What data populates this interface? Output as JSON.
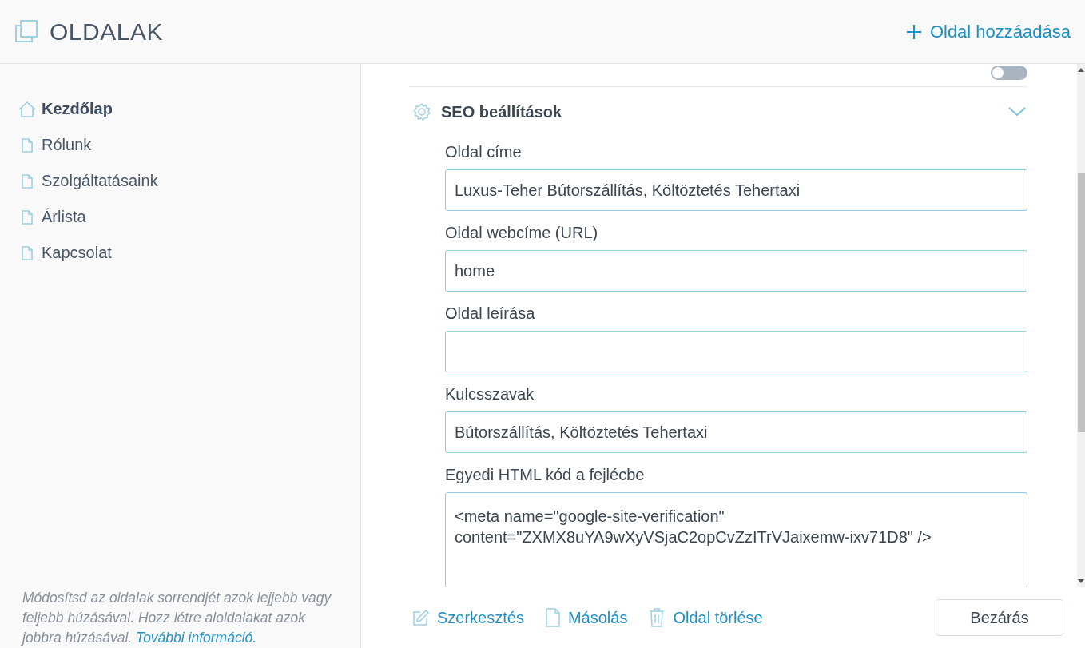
{
  "header": {
    "title": "OLDALAK",
    "add_button": "Oldal hozzáadása"
  },
  "sidebar": {
    "items": [
      {
        "label": "Kezdőlap",
        "kind": "home",
        "selected": true
      },
      {
        "label": "Rólunk",
        "kind": "page",
        "selected": false
      },
      {
        "label": "Szolgáltatásaink",
        "kind": "page",
        "selected": false
      },
      {
        "label": "Árlista",
        "kind": "page",
        "selected": false
      },
      {
        "label": "Kapcsolat",
        "kind": "page",
        "selected": false
      }
    ],
    "hint": "*Módosítsd az oldalak sorrendjét azok lejjebb vagy feljebb húzásával. Hozz létre aloldalakat azok jobbra húzásával.*",
    "hint_link": "További információ."
  },
  "access_toggle": {
    "on": false
  },
  "seo": {
    "title": "SEO beállítások",
    "expanded": true,
    "fields": [
      {
        "label": "Oldal címe",
        "value": "Luxus-Teher Bútorszállítás, Költöztetés Tehertaxi",
        "kind": "input"
      },
      {
        "label": "Oldal webcíme (URL)",
        "value": "home",
        "kind": "input"
      },
      {
        "label": "Oldal leírása",
        "kind": "input"
      },
      {
        "label": "Kulcsszavak",
        "value": "Bútorszállítás, Költöztetés Tehertaxi",
        "kind": "input"
      },
      {
        "label": "Egyedi HTML kód a fejlécbe",
        "value": "<meta name=\"google-site-verification\" content=\"ZXMX8uYA9wXyVSjaC2opCvZzITrVJaixemw-ixv71D8\" />",
        "kind": "textarea"
      }
    ]
  },
  "actions": [
    {
      "label": "Szerkesztés",
      "kind": "edit"
    },
    {
      "label": "Másolás",
      "kind": "copy"
    },
    {
      "label": "Oldal törlése",
      "kind": "delete"
    }
  ],
  "close_button": "Bezárás"
}
